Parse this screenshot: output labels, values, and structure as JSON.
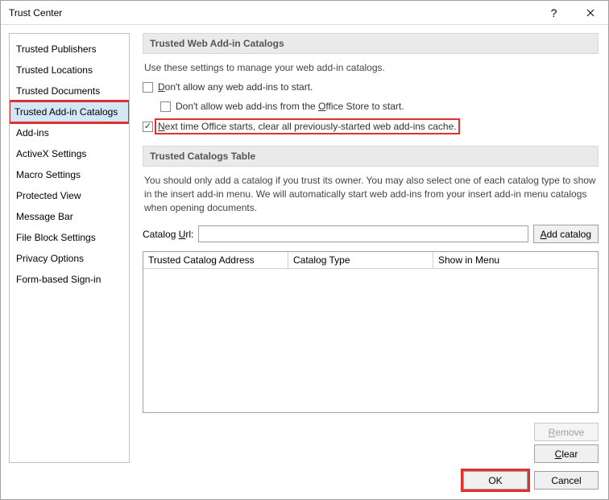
{
  "window": {
    "title": "Trust Center"
  },
  "sidebar": {
    "items": [
      {
        "label": "Trusted Publishers"
      },
      {
        "label": "Trusted Locations"
      },
      {
        "label": "Trusted Documents"
      },
      {
        "label": "Trusted Add-in Catalogs"
      },
      {
        "label": "Add-ins"
      },
      {
        "label": "ActiveX Settings"
      },
      {
        "label": "Macro Settings"
      },
      {
        "label": "Protected View"
      },
      {
        "label": "Message Bar"
      },
      {
        "label": "File Block Settings"
      },
      {
        "label": "Privacy Options"
      },
      {
        "label": "Form-based Sign-in"
      }
    ],
    "selected_index": 3
  },
  "section1": {
    "header": "Trusted Web Add-in Catalogs",
    "description": "Use these settings to manage your web add-in catalogs.",
    "check1": {
      "checked": false,
      "pre": "",
      "ul": "D",
      "post": "on't allow any web add-ins to start."
    },
    "check2": {
      "checked": false,
      "pre": "Don't allow web add-ins from the ",
      "ul": "O",
      "post": "ffice Store to start."
    },
    "check3": {
      "checked": true,
      "pre": "",
      "ul": "N",
      "post": "ext time Office starts, clear all previously-started web add-ins cache."
    }
  },
  "section2": {
    "header": "Trusted Catalogs Table",
    "help": "You should only add a catalog if you trust its owner. You may also select one of each catalog type to show in the insert add-in menu. We will automatically start web add-ins from your insert add-in menu catalogs when opening documents.",
    "url_label_pre": "Catalog ",
    "url_label_ul": "U",
    "url_label_post": "rl:",
    "url_value": "",
    "add_btn_ul": "A",
    "add_btn_post": "dd catalog",
    "columns": {
      "addr": "Trusted Catalog Address",
      "type": "Catalog Type",
      "menu": "Show in Menu"
    },
    "remove_btn_ul": "R",
    "remove_btn_post": "emove",
    "clear_btn_ul": "C",
    "clear_btn_post": "lear"
  },
  "footer": {
    "ok": "OK",
    "cancel": "Cancel"
  }
}
